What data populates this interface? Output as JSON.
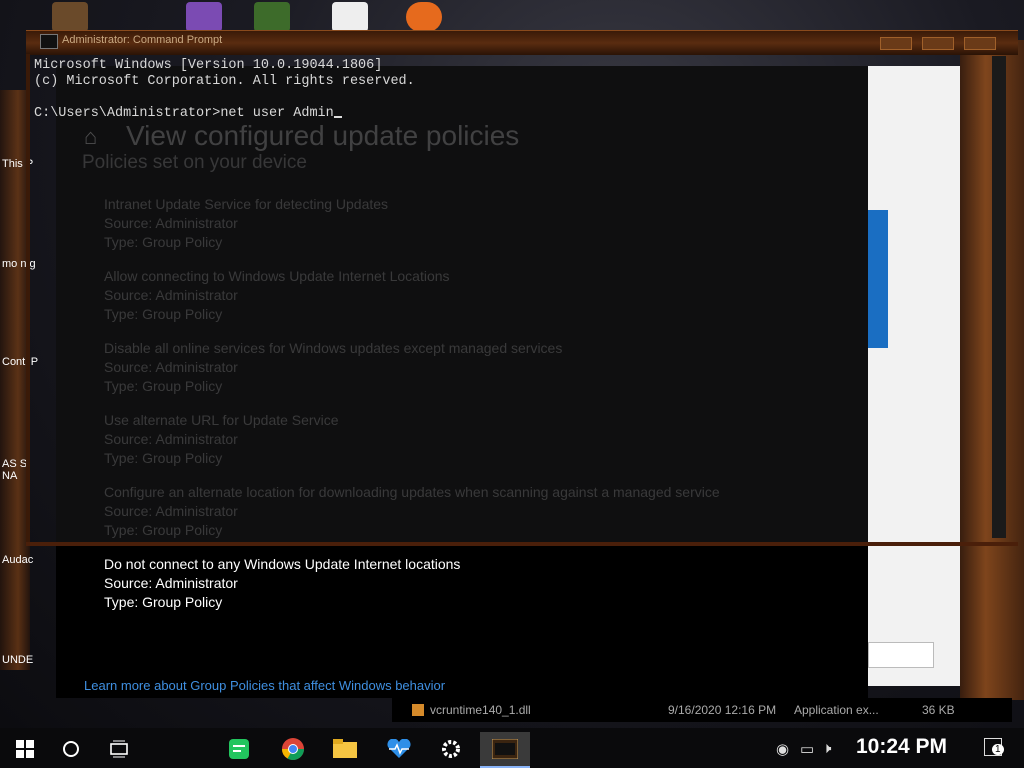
{
  "cmd": {
    "title": "Administrator: Command Prompt",
    "lines": [
      "Microsoft Windows [Version 10.0.19044.1806]",
      "(c) Microsoft Corporation. All rights reserved.",
      "",
      "C:\\Users\\Administrator>net user Admin"
    ]
  },
  "settings": {
    "page_title": "View configured update policies",
    "subheading": "Policies set on your device",
    "policies": [
      {
        "name": "Intranet Update Service for detecting Updates",
        "source": "Source: Administrator",
        "type": "Type: Group Policy"
      },
      {
        "name": "Allow connecting to Windows Update Internet Locations",
        "source": "Source: Administrator",
        "type": "Type: Group Policy"
      },
      {
        "name": "Disable all online services for Windows updates except managed services",
        "source": "Source: Administrator",
        "type": "Type: Group Policy"
      },
      {
        "name": "Use alternate URL for Update Service",
        "source": "Source: Administrator",
        "type": "Type: Group Policy"
      },
      {
        "name": "Configure an alternate location for downloading updates when scanning against a managed service",
        "source": "Source: Administrator",
        "type": "Type: Group Policy"
      },
      {
        "name": "Do not connect to any Windows Update Internet locations",
        "source": "Source: Administrator",
        "type": "Type: Group Policy"
      }
    ],
    "learn_more": "Learn more about Group Policies that affect Windows behavior"
  },
  "explorer_row": {
    "name": "vcruntime140_1.dll",
    "date": "9/16/2020 12:16 PM",
    "type": "Application ex...",
    "size": "36 KB"
  },
  "desktop": {
    "icons": [
      "This P",
      "mo n g",
      "Contl P",
      "AS S NA",
      "Audac",
      "UNDE"
    ]
  },
  "taskbar": {
    "clock": "10:24 PM",
    "notification_badge": "1",
    "apps": [
      "start-icon",
      "search-icon",
      "task-view-icon",
      "notes-icon",
      "chrome-icon",
      "file-explorer-icon",
      "health-icon",
      "settings-icon",
      "cmd-icon"
    ]
  },
  "colors": {
    "link": "#3f8fe0",
    "accent": "#8ab4f8"
  }
}
